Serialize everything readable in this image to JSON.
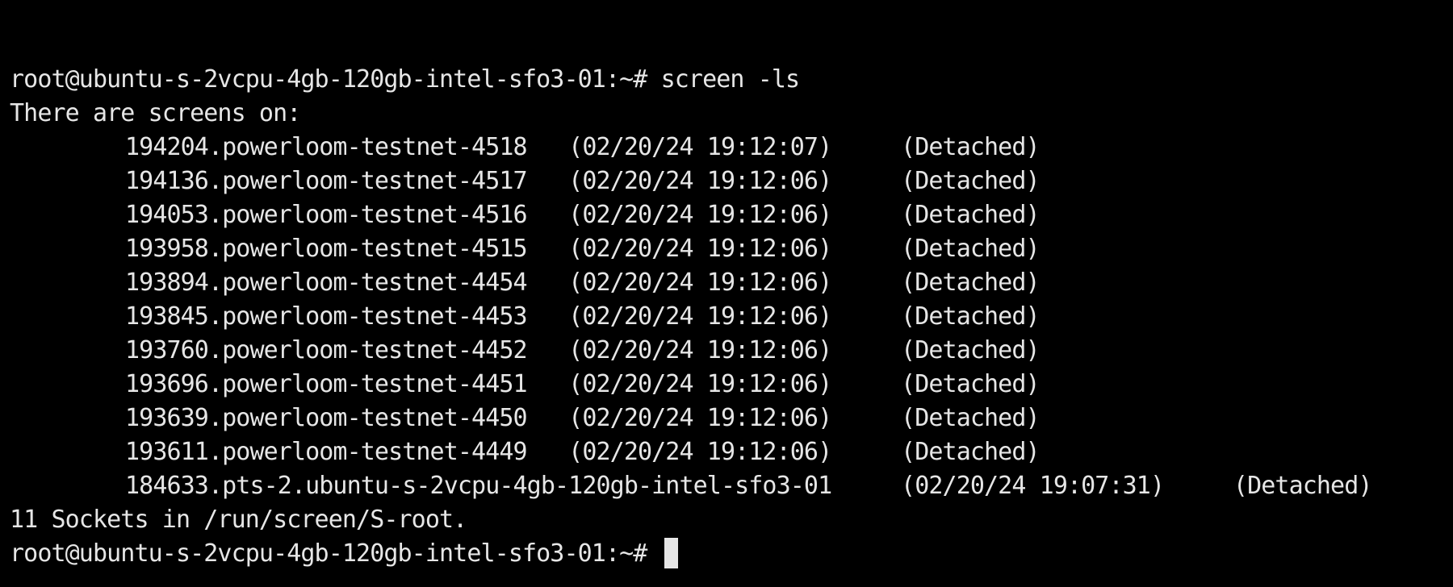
{
  "terminal": {
    "background": "#000000",
    "foreground": "#e6e6e6",
    "command_line": "root@ubuntu-s-2vcpu-4gb-120gb-intel-sfo3-01:~# screen -ls",
    "header_line": "There are screens on:",
    "sessions": [
      "194204.powerloom-testnet-4518   (02/20/24 19:12:07)     (Detached)",
      "194136.powerloom-testnet-4517   (02/20/24 19:12:06)     (Detached)",
      "194053.powerloom-testnet-4516   (02/20/24 19:12:06)     (Detached)",
      "193958.powerloom-testnet-4515   (02/20/24 19:12:06)     (Detached)",
      "193894.powerloom-testnet-4454   (02/20/24 19:12:06)     (Detached)",
      "193845.powerloom-testnet-4453   (02/20/24 19:12:06)     (Detached)",
      "193760.powerloom-testnet-4452   (02/20/24 19:12:06)     (Detached)",
      "193696.powerloom-testnet-4451   (02/20/24 19:12:06)     (Detached)",
      "193639.powerloom-testnet-4450   (02/20/24 19:12:06)     (Detached)",
      "193611.powerloom-testnet-4449   (02/20/24 19:12:06)     (Detached)",
      "184633.pts-2.ubuntu-s-2vcpu-4gb-120gb-intel-sfo3-01     (02/20/24 19:07:31)     (Detached)"
    ],
    "summary_line": "11 Sockets in /run/screen/S-root.",
    "prompt": "root@ubuntu-s-2vcpu-4gb-120gb-intel-sfo3-01:~# "
  }
}
